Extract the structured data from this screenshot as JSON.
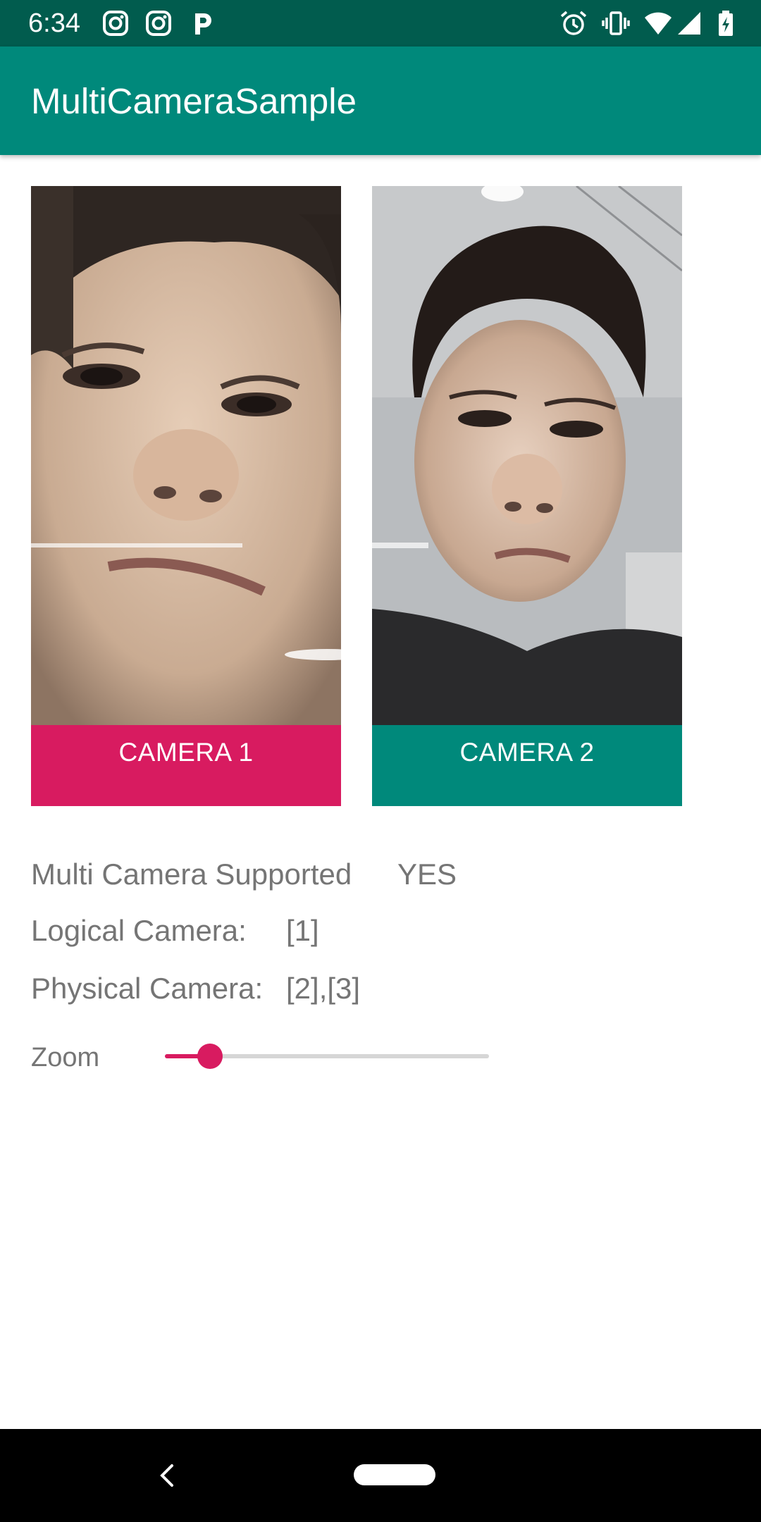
{
  "status_bar": {
    "time": "6:34",
    "icons_left": [
      "instagram-icon",
      "instagram-icon",
      "pandora-icon"
    ],
    "icons_right": [
      "alarm-icon",
      "vibrate-icon",
      "wifi-icon",
      "signal-icon",
      "battery-icon"
    ]
  },
  "app_bar": {
    "title": "MultiCameraSample"
  },
  "cameras": [
    {
      "label": "CAMERA 1",
      "color": "#d81b60"
    },
    {
      "label": "CAMERA 2",
      "color": "#00897b"
    }
  ],
  "info": {
    "multi_camera_label": "Multi Camera Supported",
    "multi_camera_value": "YES",
    "logical_label": "Logical Camera:",
    "logical_value": "[1]",
    "physical_label": "Physical Camera:",
    "physical_value": "[2],[3]"
  },
  "zoom": {
    "label": "Zoom",
    "value_fraction": 0.14
  },
  "colors": {
    "primary": "#00897b",
    "primary_dark": "#015c4e",
    "accent": "#d81b60"
  }
}
